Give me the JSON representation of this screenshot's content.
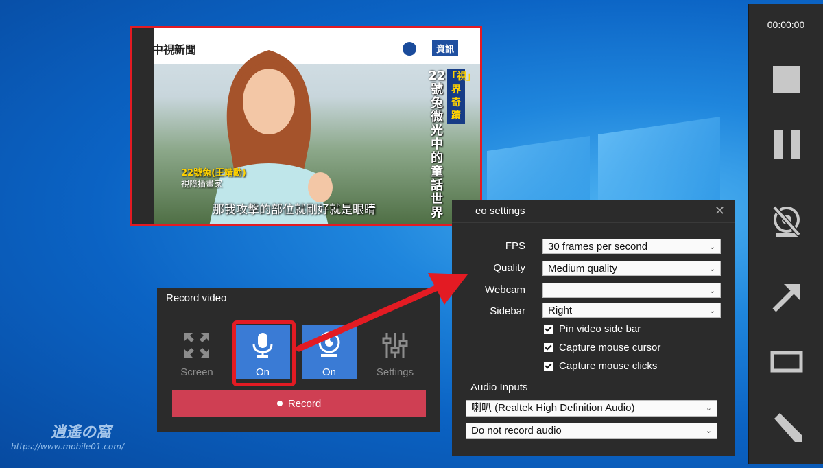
{
  "preview": {
    "show_logo": "中視新聞",
    "news_tag": "資訊",
    "title_vertical": "22號兔 微光中的童話世界",
    "title_vertical_2": "「視」界奇蹟",
    "name": "22號兔(王靖勳)",
    "role": "視障插畫家",
    "subtitle": "那我攻擊的部位就剛好就是眼睛"
  },
  "record_panel": {
    "title": "Record video",
    "tiles": [
      {
        "label": "Screen"
      },
      {
        "label": "On"
      },
      {
        "label": "On"
      },
      {
        "label": "Settings"
      }
    ],
    "record_label": "Record"
  },
  "settings": {
    "title": "eo settings",
    "close_glyph": "✕",
    "fps_label": "FPS",
    "fps_value": "30 frames per second",
    "quality_label": "Quality",
    "quality_value": "Medium quality",
    "webcam_label": "Webcam",
    "webcam_value": "",
    "sidebar_label": "Sidebar",
    "sidebar_value": "Right",
    "checks": [
      {
        "label": "Pin video side bar",
        "checked": true
      },
      {
        "label": "Capture mouse cursor",
        "checked": true
      },
      {
        "label": "Capture mouse clicks",
        "checked": true
      }
    ],
    "audio_inputs_label": "Audio Inputs",
    "audio_input_1": "喇叭 (Realtek High Definition Audio)",
    "audio_input_2": "Do not record audio"
  },
  "sidebar": {
    "timer": "00:00:00",
    "icons": [
      "stop-icon",
      "pause-icon",
      "webcam-off-icon",
      "arrow-icon",
      "rectangle-icon",
      "pen-icon"
    ]
  },
  "watermark": {
    "title": "逍遙の窩",
    "url": "https://www.mobile01.com/"
  },
  "colors": {
    "accent_blue": "#3a7bd5",
    "record_red": "#cf3f53",
    "highlight_red": "#e31b23",
    "panel_bg": "#2b2b2b"
  }
}
